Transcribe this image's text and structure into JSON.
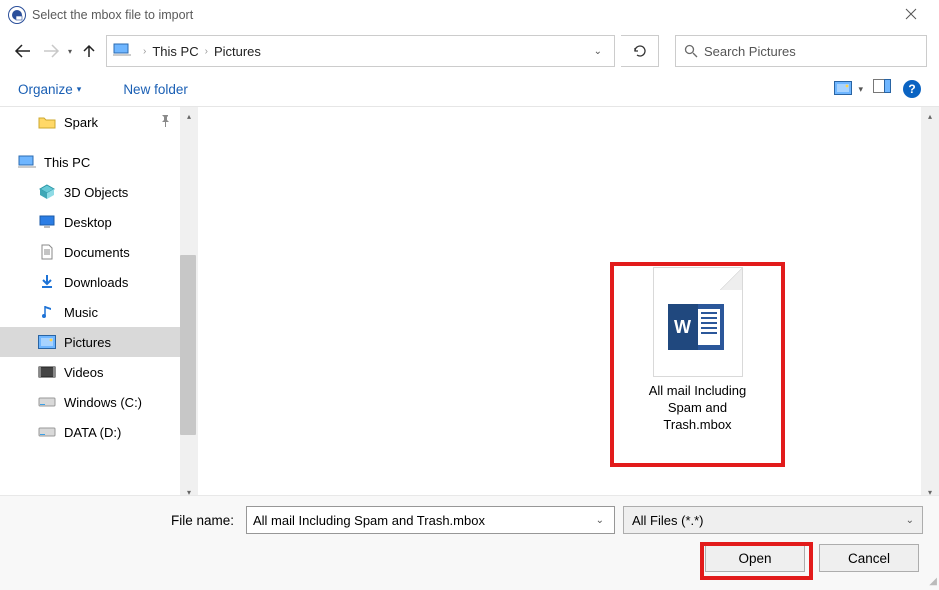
{
  "title": "Select the mbox file to import",
  "nav": {
    "breadcrumb": [
      "This PC",
      "Pictures"
    ],
    "search_placeholder": "Search Pictures"
  },
  "toolbar": {
    "organize": "Organize",
    "new_folder": "New folder"
  },
  "sidebar": {
    "pinned_folder": "Spark",
    "this_pc": "This PC",
    "items": [
      {
        "label": "3D Objects",
        "icon": "cube"
      },
      {
        "label": "Desktop",
        "icon": "desktop"
      },
      {
        "label": "Documents",
        "icon": "document"
      },
      {
        "label": "Downloads",
        "icon": "download"
      },
      {
        "label": "Music",
        "icon": "music"
      },
      {
        "label": "Pictures",
        "icon": "pictures",
        "selected": true
      },
      {
        "label": "Videos",
        "icon": "video"
      },
      {
        "label": "Windows (C:)",
        "icon": "drive"
      },
      {
        "label": "DATA (D:)",
        "icon": "drive"
      }
    ]
  },
  "content": {
    "file_label_l1": "All mail Including",
    "file_label_l2": "Spam and",
    "file_label_l3": "Trash.mbox"
  },
  "bottom": {
    "filename_label": "File name:",
    "filename_value": "All mail Including Spam and Trash.mbox",
    "filetype": "All Files (*.*)",
    "open": "Open",
    "cancel": "Cancel"
  }
}
